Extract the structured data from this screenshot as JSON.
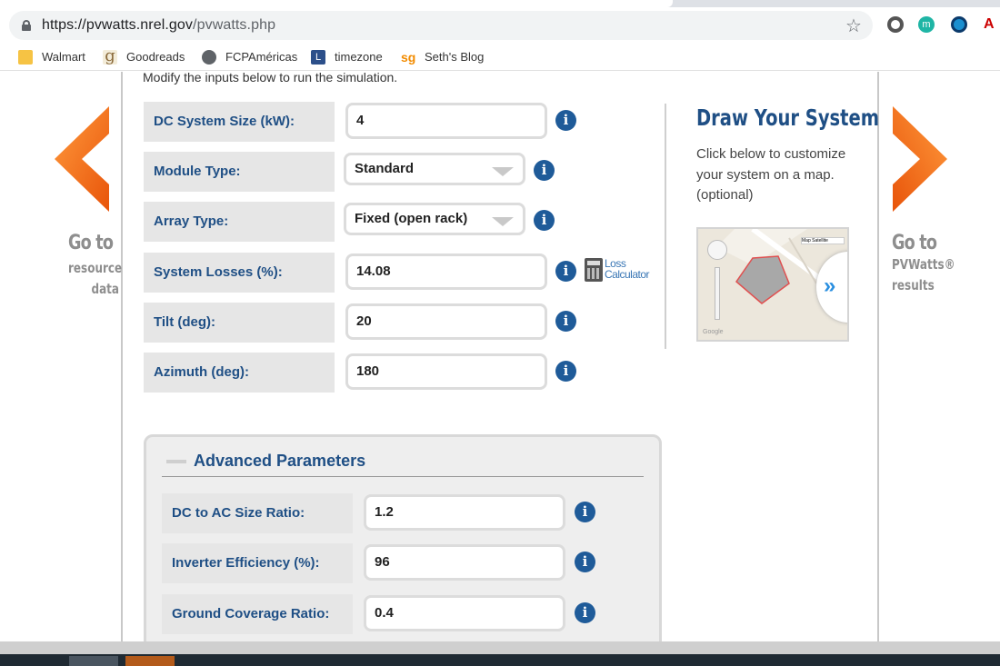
{
  "browser": {
    "url_host": "https://pvwatts.nrel.gov",
    "url_path": "/pvwatts.php",
    "bookmarks": [
      {
        "label": "Walmart",
        "icon": "folder-icon"
      },
      {
        "label": "Goodreads",
        "icon": "goodreads-icon"
      },
      {
        "label": "FCPAméricas",
        "icon": "globe-icon"
      },
      {
        "label": "timezone",
        "icon": "timezone-icon"
      },
      {
        "label": "Seth's Blog",
        "icon": "sethsblog-icon"
      }
    ],
    "extensions": {
      "m_label": "m",
      "pdf_label": "A"
    }
  },
  "page": {
    "intro": "Modify the inputs below to run the simulation.",
    "left_nav": {
      "big": "Go to",
      "line1": "resource",
      "line2": "data"
    },
    "right_nav": {
      "big": "Go to",
      "line1": "PVWatts®",
      "line2": "results"
    },
    "inputs": [
      {
        "label": "DC System Size (kW):",
        "value": "4",
        "kind": "text"
      },
      {
        "label": "Module Type:",
        "value": "Standard",
        "kind": "select"
      },
      {
        "label": "Array Type:",
        "value": "Fixed (open rack)",
        "kind": "select"
      },
      {
        "label": "System Losses (%):",
        "value": "14.08",
        "kind": "text"
      },
      {
        "label": "Tilt (deg):",
        "value": "20",
        "kind": "text"
      },
      {
        "label": "Azimuth (deg):",
        "value": "180",
        "kind": "text"
      }
    ],
    "info_glyph": "i",
    "loss_calculator": {
      "line1": "Loss",
      "line2": "Calculator"
    },
    "draw": {
      "title": "Draw Your System",
      "description": "Click below to customize your system on a map. (optional)",
      "map_buttons": "Map  Satellite",
      "map_credit": "Google",
      "map_arrow": "»"
    },
    "advanced": {
      "title": "Advanced Parameters",
      "inputs": [
        {
          "label": "DC to AC Size Ratio:",
          "value": "1.2"
        },
        {
          "label": "Inverter Efficiency (%):",
          "value": "96"
        },
        {
          "label": "Ground Coverage Ratio:",
          "value": "0.4"
        }
      ]
    }
  },
  "colors": {
    "label_text": "#1f4f85",
    "info_icon": "#1f5b99",
    "nav_arrow": "#f26a0a"
  }
}
